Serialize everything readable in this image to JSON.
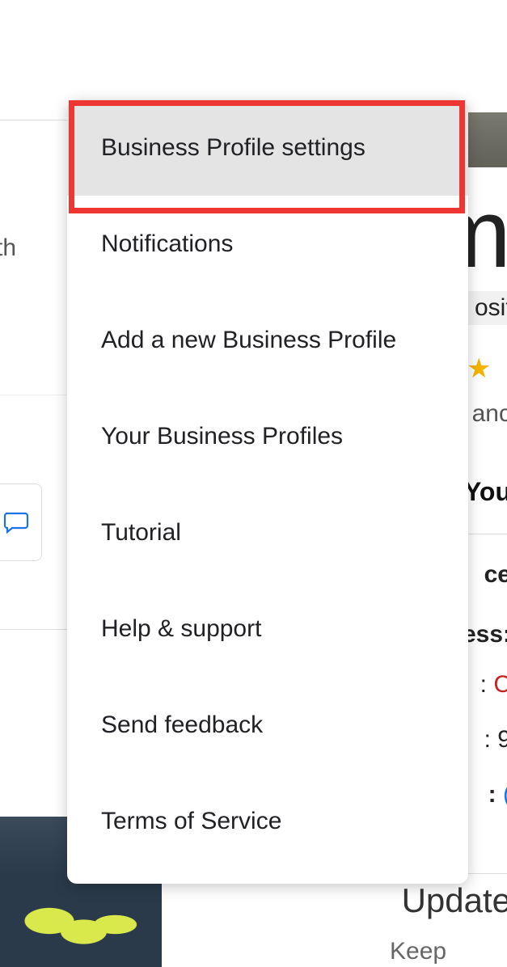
{
  "menu": {
    "items": [
      {
        "label": "Business Profile settings",
        "selected": true
      },
      {
        "label": "Notifications",
        "selected": false
      },
      {
        "label": "Add a new Business Profile",
        "selected": false
      },
      {
        "label": "Your Business Profiles",
        "selected": false
      },
      {
        "label": "Tutorial",
        "selected": false
      },
      {
        "label": "Help & support",
        "selected": false
      },
      {
        "label": "Send feedback",
        "selected": false
      },
      {
        "label": "Terms of Service",
        "selected": false
      }
    ]
  },
  "bg_fragments": {
    "big_letter": "m",
    "site": "osite",
    "star": "★",
    "anc": "anc",
    "you": "You",
    "ce": "ce",
    "ess": "ess:",
    "s_colon": ":",
    "c_letter": "C",
    "nine": ": 9",
    "e_bold": ":",
    "paren": "(",
    "th": "th",
    "update": "Update",
    "keep": "Keep"
  }
}
